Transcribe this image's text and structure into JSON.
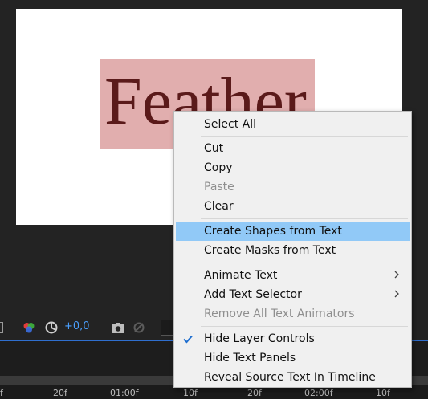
{
  "composition": {
    "text_layer": "Feather"
  },
  "context_menu": {
    "items": [
      {
        "label": "Select All",
        "enabled": true
      },
      {
        "label": "Cut",
        "enabled": true
      },
      {
        "label": "Copy",
        "enabled": true
      },
      {
        "label": "Paste",
        "enabled": false
      },
      {
        "label": "Clear",
        "enabled": true
      },
      {
        "label": "Create Shapes from Text",
        "enabled": true,
        "highlighted": true
      },
      {
        "label": "Create Masks from Text",
        "enabled": true
      },
      {
        "label": "Animate Text",
        "enabled": true,
        "submenu": true
      },
      {
        "label": "Add Text Selector",
        "enabled": true,
        "submenu": true
      },
      {
        "label": "Remove All Text Animators",
        "enabled": false
      },
      {
        "label": "Hide Layer Controls",
        "enabled": true,
        "checked": true
      },
      {
        "label": "Hide Text Panels",
        "enabled": true
      },
      {
        "label": "Reveal Source Text In Timeline",
        "enabled": true
      }
    ]
  },
  "toolbar": {
    "offset_value": "+0,0",
    "icons": [
      "rgb-channels-icon",
      "motion-blur-icon",
      "snapshot-icon",
      "show-snapshot-icon"
    ]
  },
  "timeline": {
    "ruler_labels": [
      "f",
      "20f",
      "01:00f",
      "10f",
      "20f",
      "02:00f",
      "10f"
    ]
  },
  "colors": {
    "highlight": "#91c9f7",
    "text_layer_fill": "#e1aeae",
    "text_color": "#5a1a1a",
    "accent_blue": "#4aa0ff"
  }
}
